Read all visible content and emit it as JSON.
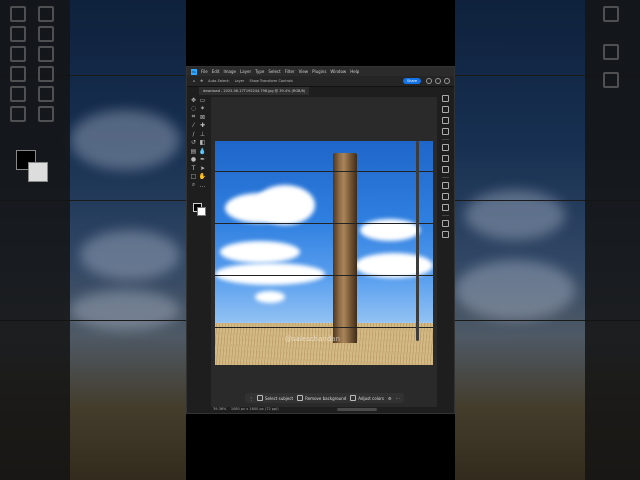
{
  "menu": {
    "items": [
      "File",
      "Edit",
      "Image",
      "Layer",
      "Type",
      "Select",
      "Filter",
      "View",
      "Plugins",
      "Window",
      "Help"
    ]
  },
  "options_bar": {
    "auto_select_label": "Auto-Select:",
    "auto_select_value": "Layer",
    "transform_label": "Show Transform Controls",
    "share_label": "Share"
  },
  "document": {
    "tab_label": "download - 2025-06-17T195244.798.jpg @ 39.4% (RGB/8)"
  },
  "canvas": {
    "watermark": "@saleschandan"
  },
  "contextual_taskbar": {
    "select_subject": "Select subject",
    "remove_background": "Remove background",
    "adjust_colors": "Adjust colors"
  },
  "status_bar": {
    "zoom": "39.36%",
    "dimensions": "1080 px x 1600 px (72 ppi)"
  },
  "colors": {
    "accent": "#1473e6",
    "foreground_swatch": "#000000",
    "background_swatch": "#ffffff"
  }
}
